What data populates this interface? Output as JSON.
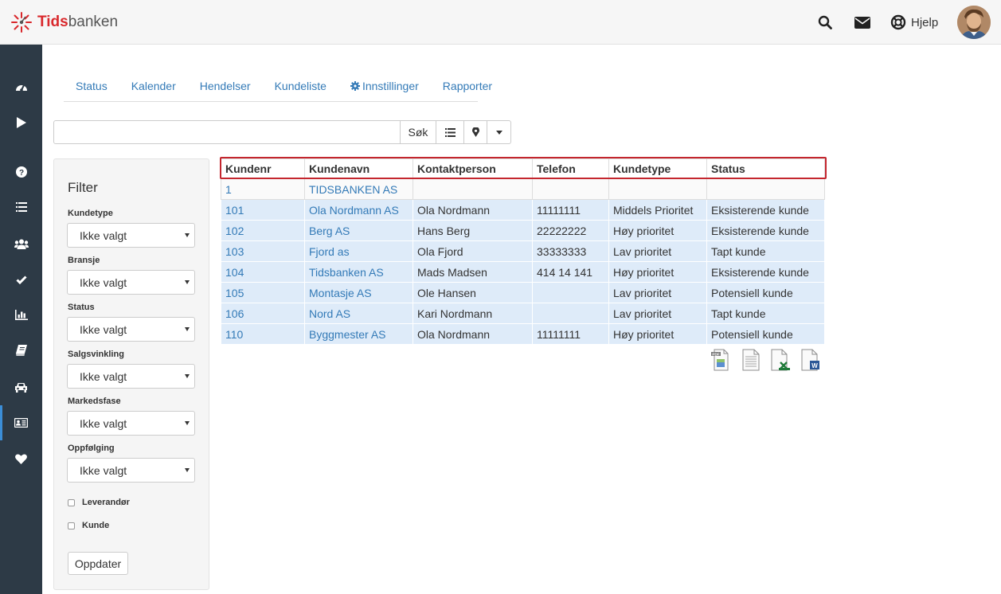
{
  "brand": {
    "name_part1": "Tids",
    "name_part2": "banken",
    "accent": "#d9282c"
  },
  "topbar": {
    "search_icon": "search-icon",
    "mail_icon": "envelope-icon",
    "help_icon": "lifebuoy-icon",
    "help_label": "Hjelp",
    "avatar": "user-avatar"
  },
  "sidebar": {
    "background": "#2d3a46",
    "items": [
      {
        "icon": "dashboard-icon"
      },
      {
        "icon": "play-icon"
      },
      {
        "icon": "question-icon"
      },
      {
        "icon": "list-icon"
      },
      {
        "icon": "users-icon"
      },
      {
        "icon": "check-icon"
      },
      {
        "icon": "bar-chart-icon"
      },
      {
        "icon": "book-icon"
      },
      {
        "icon": "car-icon"
      },
      {
        "icon": "contact-card-icon",
        "active": true
      },
      {
        "icon": "heart-icon"
      }
    ]
  },
  "tabs": [
    {
      "label": "Status"
    },
    {
      "label": "Kalender"
    },
    {
      "label": "Hendelser"
    },
    {
      "label": "Kundeliste"
    },
    {
      "label": "Innstillinger",
      "icon": "gear-icon"
    },
    {
      "label": "Rapporter"
    }
  ],
  "search": {
    "value": "",
    "button_label": "Søk",
    "list_view_icon": "list-icon",
    "map_view_icon": "map-marker-icon",
    "dropdown_icon": "caret-down-icon"
  },
  "filter": {
    "title": "Filter",
    "fields": [
      {
        "label": "Kundetype",
        "value": "Ikke valgt"
      },
      {
        "label": "Bransje",
        "value": "Ikke valgt"
      },
      {
        "label": "Status",
        "value": "Ikke valgt"
      },
      {
        "label": "Salgsvinkling",
        "value": "Ikke valgt"
      },
      {
        "label": "Markedsfase",
        "value": "Ikke valgt"
      },
      {
        "label": "Oppfølging",
        "value": "Ikke valgt"
      }
    ],
    "checkboxes": [
      {
        "label": "Leverandør",
        "checked": false
      },
      {
        "label": "Kunde",
        "checked": false
      }
    ],
    "update_label": "Oppdater"
  },
  "table": {
    "columns": [
      "Kundenr",
      "Kundenavn",
      "Kontaktperson",
      "Telefon",
      "Kundetype",
      "Status"
    ],
    "rows": [
      [
        "1",
        "TIDSBANKEN AS",
        "",
        "",
        "",
        ""
      ],
      [
        "101",
        "Ola Nordmann AS",
        "Ola Nordmann",
        "11111111",
        "Middels Prioritet",
        "Eksisterende kunde"
      ],
      [
        "102",
        "Berg AS",
        "Hans Berg",
        "22222222",
        "Høy prioritet",
        "Eksisterende kunde"
      ],
      [
        "103",
        "Fjord as",
        "Ola Fjord",
        "33333333",
        "Lav prioritet",
        "Tapt kunde"
      ],
      [
        "104",
        "Tidsbanken AS",
        "Mads Madsen",
        "414 14 141",
        "Høy prioritet",
        "Eksisterende kunde"
      ],
      [
        "105",
        "Montasje AS",
        "Ole Hansen",
        "",
        "Lav prioritet",
        "Potensiell kunde"
      ],
      [
        "106",
        "Nord AS",
        "Kari Nordmann",
        "",
        "Lav prioritet",
        "Tapt kunde"
      ],
      [
        "110",
        "Byggmester AS",
        "Ola Nordmann",
        "11111111",
        "Høy prioritet",
        "Potensiell kunde"
      ]
    ],
    "highlight_color": "#deebf9",
    "header_frame_color": "#c4262e"
  },
  "export": [
    {
      "icon": "export-pdf-icon"
    },
    {
      "icon": "export-csv-icon"
    },
    {
      "icon": "export-excel-icon"
    },
    {
      "icon": "export-word-icon"
    }
  ]
}
